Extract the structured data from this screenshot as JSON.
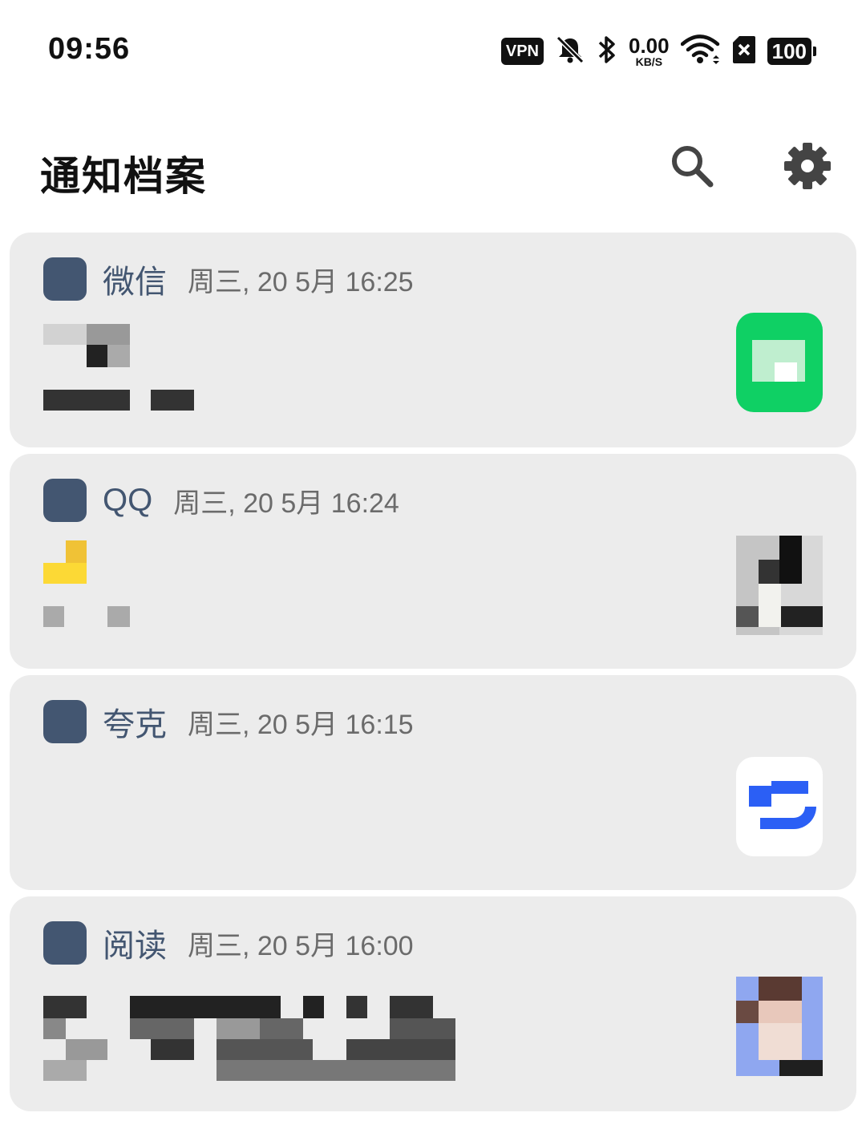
{
  "status_bar": {
    "time": "09:56",
    "vpn_label": "VPN",
    "net_speed_value": "0.00",
    "net_speed_unit": "KB/S",
    "battery_level": "100",
    "icons": [
      "vpn-icon",
      "mute-bell-icon",
      "bluetooth-icon",
      "net-speed",
      "wifi-icon",
      "no-sim-icon",
      "battery-icon"
    ]
  },
  "header": {
    "title": "通知档案",
    "search_icon": "search-icon",
    "settings_icon": "gear-icon"
  },
  "notifications": [
    {
      "app_name": "微信",
      "time": "周三, 20 5月 16:25",
      "thumb_color": "#0fd064"
    },
    {
      "app_name": "QQ",
      "time": "周三, 20 5月 16:24",
      "thumb_color": "#8a8f8f"
    },
    {
      "app_name": "夸克",
      "time": "周三, 20 5月 16:15",
      "thumb_color": "#2b5ff5"
    },
    {
      "app_name": "阅读",
      "time": "周三, 20 5月 16:00",
      "thumb_color": "#8fa7f0"
    }
  ],
  "colors": {
    "card_bg": "#ececec",
    "app_icon": "#435671",
    "app_name": "#435671",
    "time_text": "#6b6b6b"
  }
}
